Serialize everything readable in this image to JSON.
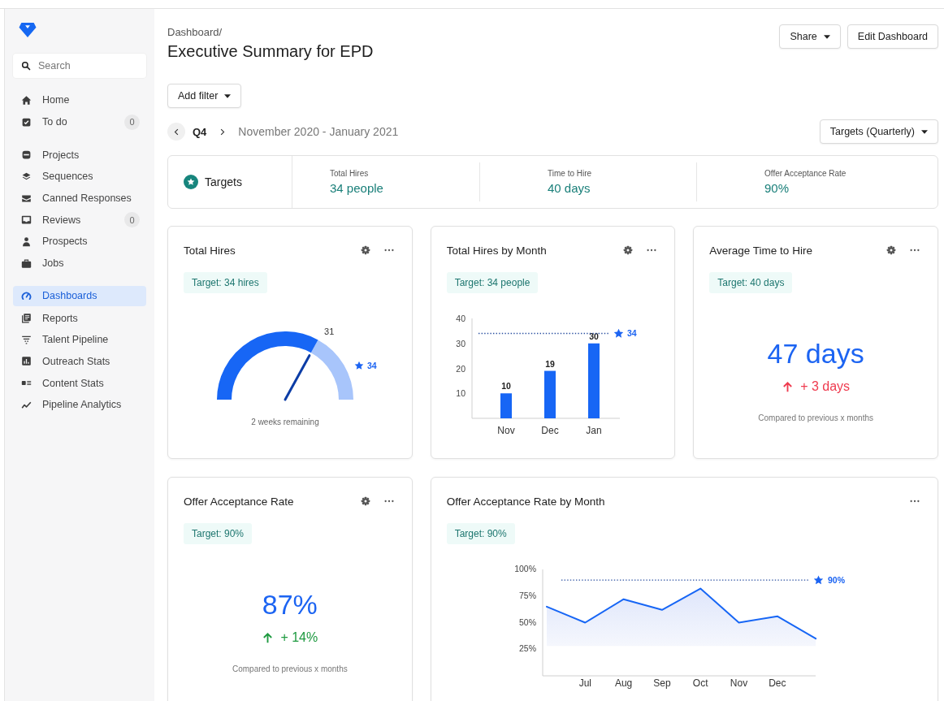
{
  "sidebar": {
    "search": {
      "placeholder": "Search"
    },
    "sections": [
      {
        "items": [
          {
            "label": "Home",
            "selected": false
          },
          {
            "label": "To do",
            "badge": "0",
            "selected": false
          }
        ]
      },
      {
        "items": [
          {
            "label": "Projects",
            "selected": false
          },
          {
            "label": "Sequences",
            "selected": false
          },
          {
            "label": "Canned Responses",
            "selected": false
          },
          {
            "label": "Reviews",
            "badge": "0",
            "selected": false
          },
          {
            "label": "Prospects",
            "selected": false
          },
          {
            "label": "Jobs",
            "selected": false
          }
        ]
      },
      {
        "items": [
          {
            "label": "Dashboards",
            "selected": true
          },
          {
            "label": "Reports",
            "selected": false
          },
          {
            "label": "Talent Pipeline",
            "selected": false
          },
          {
            "label": "Outreach Stats",
            "selected": false
          },
          {
            "label": "Content Stats",
            "selected": false
          },
          {
            "label": "Pipeline Analytics",
            "selected": false
          }
        ]
      }
    ]
  },
  "header": {
    "breadcrumb": "Dashboard/",
    "title": "Executive Summary for EPD",
    "buttons": [
      {
        "label": "Share",
        "dropdown": true
      },
      {
        "label": "Edit Dashboard",
        "dropdown": false
      }
    ]
  },
  "filter_button": {
    "label": "Add filter"
  },
  "period": {
    "quarter": "Q4",
    "range": "November 2020 - January 2021",
    "view_select": "Targets (Quarterly)"
  },
  "targets": {
    "label": "Targets",
    "items": [
      {
        "label": "Total Hires",
        "value": "34 people"
      },
      {
        "label": "Time to Hire",
        "value": "40 days"
      },
      {
        "label": "Offer Acceptance Rate",
        "value": "90%"
      }
    ]
  },
  "cards": [
    {
      "kind": "gauge",
      "title": "Total Hires",
      "settings": true,
      "target": "Target: 34 hires",
      "gauge": {
        "value_label": "31",
        "target_label": "34",
        "caption": "2 weeks remaining"
      }
    },
    {
      "kind": "chart",
      "title": "Total Hires by Month",
      "settings": true,
      "target": "Target: 34 people",
      "chart_data": {
        "type": "bar",
        "categories": [
          "Nov",
          "Dec",
          "Jan"
        ],
        "values": [
          10,
          19,
          30
        ],
        "ylim": [
          0,
          40
        ],
        "yticks": [
          10,
          20,
          30,
          40
        ],
        "data_labels": true,
        "ref_lines": [
          {
            "axis": "y",
            "value": 34,
            "label": "34"
          }
        ]
      }
    },
    {
      "kind": "number",
      "title": "Average Time to Hire",
      "settings": true,
      "target": "Target: 40 days",
      "value": "47 days",
      "delta": {
        "text": "+ 3 days",
        "color": "#ef3b4f"
      },
      "caption": "Compared to previous x months"
    },
    {
      "kind": "number",
      "title": "Offer Acceptance Rate",
      "settings": true,
      "target": "Target: 90%",
      "value": "87%",
      "delta": {
        "text": "+ 14%",
        "color": "#1e9a40"
      },
      "caption": "Compared to previous x months"
    },
    {
      "kind": "chart",
      "title": "Offer Acceptance Rate by Month",
      "settings": false,
      "target": "Target: 90%",
      "chart_data": {
        "type": "line",
        "categories": [
          null,
          "Jul",
          "Aug",
          "Sep",
          "Oct",
          "Nov",
          "Dec",
          null
        ],
        "values": [
          65,
          50,
          72,
          62,
          82,
          50,
          56,
          35
        ],
        "ylim": [
          0,
          100
        ],
        "yticks": [
          {
            "value": 25,
            "label": "25%"
          },
          {
            "value": 50,
            "label": "50%"
          },
          {
            "value": 75,
            "label": "75%"
          },
          {
            "value": 100,
            "label": "100%"
          }
        ],
        "ref_lines": [
          {
            "axis": "y",
            "value": 90,
            "label": "90%"
          }
        ]
      }
    }
  ]
}
